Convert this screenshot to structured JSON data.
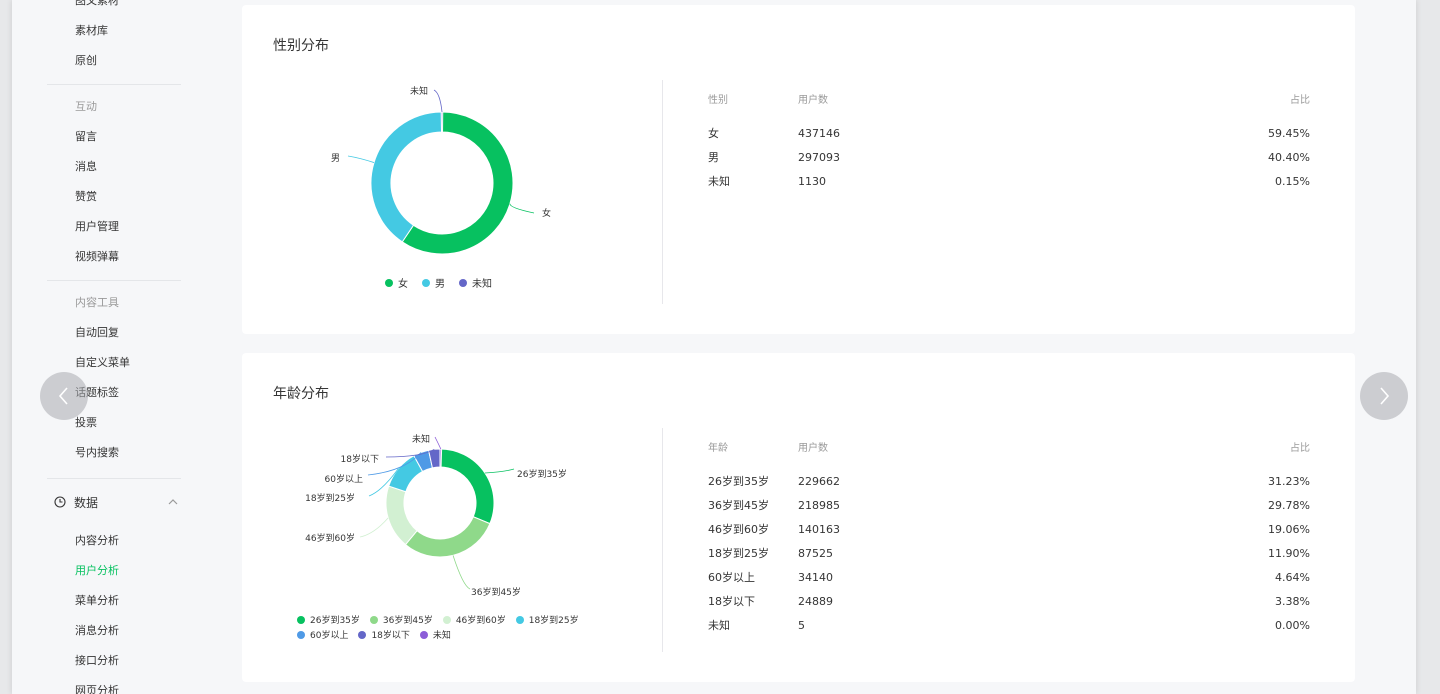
{
  "sidebar": {
    "top_items": [
      "图文素材",
      "素材库",
      "原创"
    ],
    "group_interact": {
      "title": "互动",
      "items": [
        "留言",
        "消息",
        "赞赏",
        "用户管理",
        "视频弹幕"
      ]
    },
    "group_tools": {
      "title": "内容工具",
      "items": [
        "自动回复",
        "自定义菜单",
        "话题标签",
        "投票",
        "号内搜索"
      ]
    },
    "section_data": {
      "title": "数据",
      "items": [
        "内容分析",
        "用户分析",
        "菜单分析",
        "消息分析",
        "接口分析",
        "网页分析"
      ],
      "active_index": 1
    }
  },
  "gender": {
    "title": "性别分布",
    "table_headers": [
      "性别",
      "用户数",
      "占比"
    ],
    "rows": [
      {
        "label": "女",
        "users": "437146",
        "ratio": "59.45%"
      },
      {
        "label": "男",
        "users": "297093",
        "ratio": "40.40%"
      },
      {
        "label": "未知",
        "users": "1130",
        "ratio": "0.15%"
      }
    ]
  },
  "age": {
    "title": "年龄分布",
    "table_headers": [
      "年龄",
      "用户数",
      "占比"
    ],
    "rows": [
      {
        "label": "26岁到35岁",
        "users": "229662",
        "ratio": "31.23%"
      },
      {
        "label": "36岁到45岁",
        "users": "218985",
        "ratio": "29.78%"
      },
      {
        "label": "46岁到60岁",
        "users": "140163",
        "ratio": "19.06%"
      },
      {
        "label": "18岁到25岁",
        "users": "87525",
        "ratio": "11.90%"
      },
      {
        "label": "60岁以上",
        "users": "34140",
        "ratio": "4.64%"
      },
      {
        "label": "18岁以下",
        "users": "24889",
        "ratio": "3.38%"
      },
      {
        "label": "未知",
        "users": "5",
        "ratio": "0.00%"
      }
    ]
  },
  "chart_data": [
    {
      "type": "pie",
      "categories": [
        "女",
        "男",
        "未知"
      ],
      "values": [
        437146,
        297093,
        1130
      ],
      "colors": [
        "#07c160",
        "#44c9e3",
        "#6467c8"
      ],
      "legend_position": "bottom"
    },
    {
      "type": "pie",
      "categories": [
        "26岁到35岁",
        "36岁到45岁",
        "46岁到60岁",
        "18岁到25岁",
        "60岁以上",
        "18岁以下",
        "未知"
      ],
      "values": [
        229662,
        218985,
        140163,
        87525,
        34140,
        24889,
        5
      ],
      "colors": [
        "#07c160",
        "#8fd98a",
        "#d2f0d2",
        "#44c9e3",
        "#4f9ae6",
        "#6467c8",
        "#8c5dd8"
      ],
      "legend_position": "bottom"
    }
  ],
  "icons": {
    "prev": "chevron-left-icon",
    "next": "chevron-right-icon",
    "section": "clock-icon",
    "collapse": "chevron-up-icon"
  }
}
